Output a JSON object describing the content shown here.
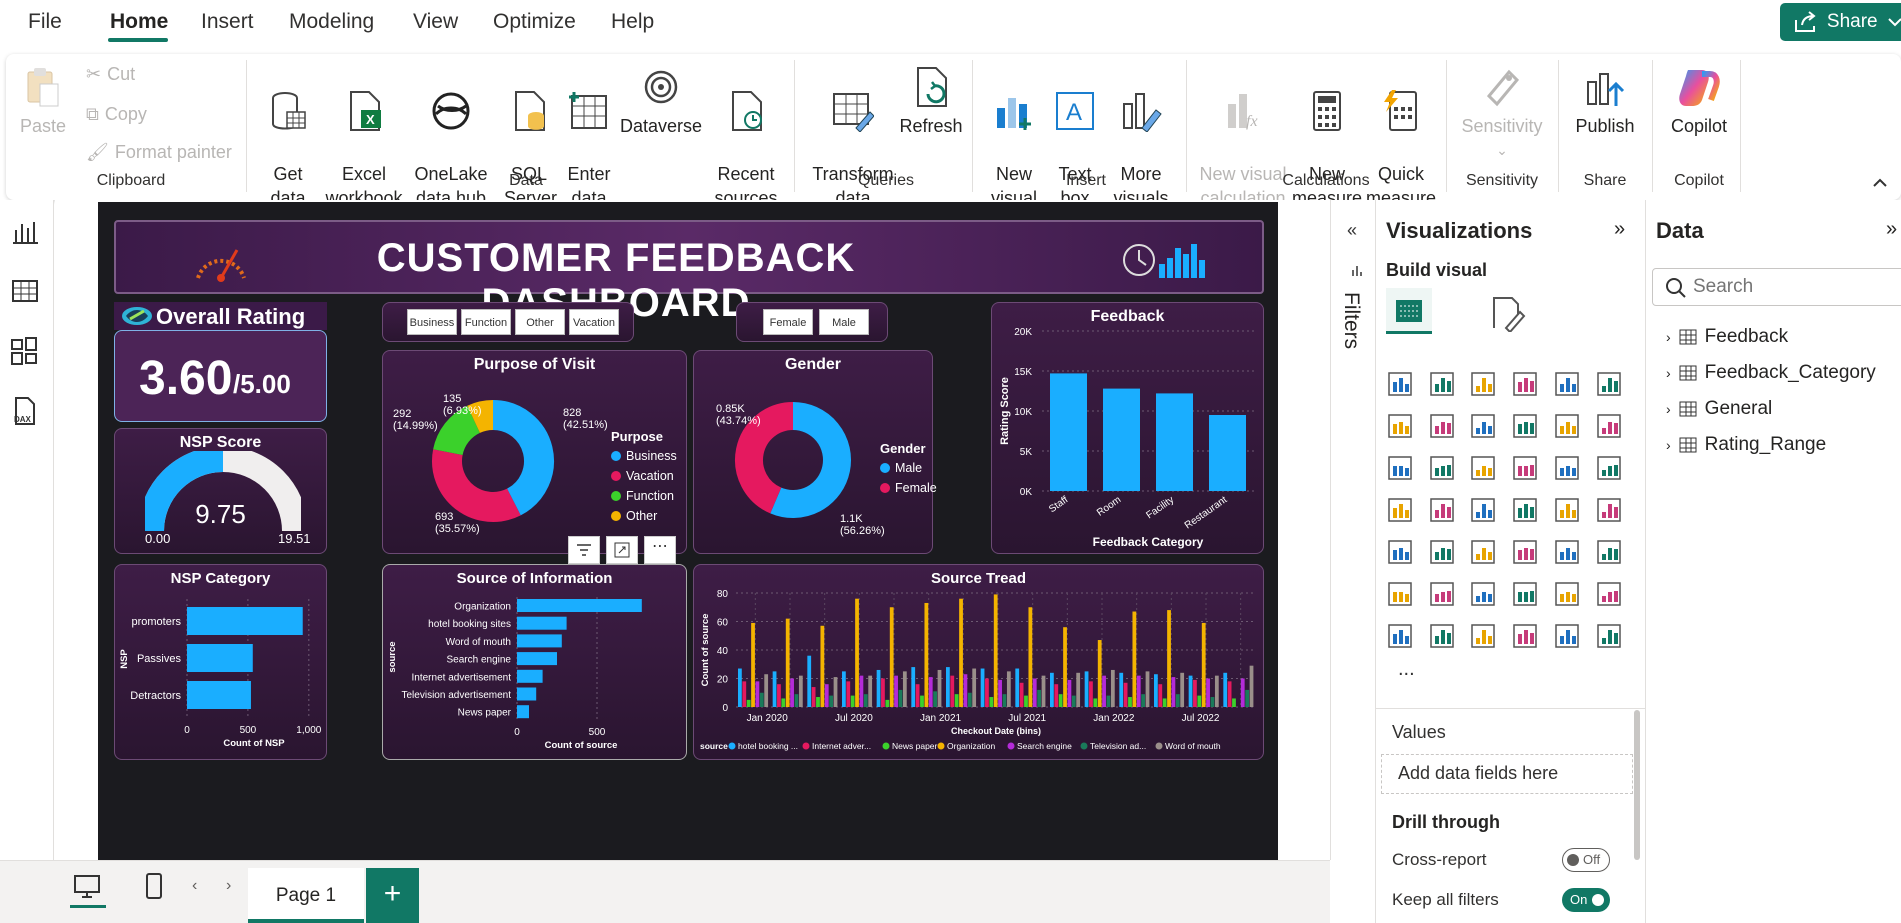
{
  "menu": {
    "items": [
      "File",
      "Home",
      "Insert",
      "Modeling",
      "View",
      "Optimize",
      "Help"
    ],
    "active": "Home",
    "share_label": "Share"
  },
  "ribbon": {
    "clipboard": {
      "paste": "Paste",
      "cut": "Cut",
      "copy": "Copy",
      "format_painter": "Format painter",
      "group": "Clipboard"
    },
    "data": {
      "get_data": "Get\ndata",
      "excel": "Excel\nworkbook",
      "onelake": "OneLake\ndata hub",
      "sql": "SQL\nServer",
      "enter": "Enter\ndata",
      "dataverse": "Dataverse",
      "recent": "Recent\nsources",
      "group": "Data"
    },
    "queries": {
      "transform": "Transform\ndata",
      "refresh": "Refresh",
      "group": "Queries"
    },
    "insert": {
      "new_visual": "New\nvisual",
      "text_box": "Text\nbox",
      "more_visuals": "More\nvisuals",
      "group": "Insert"
    },
    "calculations": {
      "new_visual_calc": "New visual\ncalculation",
      "new_measure": "New\nmeasure",
      "quick_measure": "Quick\nmeasure",
      "group": "Calculations"
    },
    "sensitivity": {
      "label": "Sensitivity",
      "group": "Sensitivity"
    },
    "share": {
      "publish": "Publish",
      "group": "Share"
    },
    "copilot": {
      "label": "Copilot",
      "group": "Copilot"
    }
  },
  "dashboard": {
    "title": "CUSTOMER FEEDBACK DASHBOARD",
    "overall_rating": {
      "label": "Overall Rating",
      "value": "3.60",
      "max": "/5.00"
    },
    "nsp_score": {
      "title": "NSP Score",
      "value": "9.75",
      "min": "0.00",
      "max": "19.51",
      "fraction": 0.5
    },
    "purpose_slicer": [
      "Business",
      "Function",
      "Other",
      "Vacation"
    ],
    "gender_slicer": [
      "Female",
      "Male"
    ],
    "purpose_of_visit": {
      "title": "Purpose of Visit",
      "legend_title": "Purpose",
      "labels": {
        "business": "828\n(42.51%)",
        "vacation": "693\n(35.57%)",
        "function": "292\n(14.99%)",
        "other": "135\n(6.93%)"
      }
    },
    "gender": {
      "title": "Gender",
      "legend_title": "Gender",
      "labels": {
        "female": "0.85K\n(43.74%)",
        "male": "1.1K\n(56.26%)"
      }
    },
    "nsp_category": {
      "title": "NSP Category",
      "ylabel": "NSP",
      "xlabel": "Count of NSP",
      "ticks": [
        "0",
        "500",
        "1,000"
      ]
    },
    "source_info": {
      "title": "Source of Information",
      "ylabel": "source",
      "xlabel": "Count of source",
      "ticks": [
        "0",
        "500"
      ]
    },
    "feedback": {
      "title": "Feedback",
      "ylabel": "Rating Score",
      "xlabel": "Feedback Category",
      "ticks": [
        "0K",
        "5K",
        "10K",
        "15K",
        "20K"
      ]
    },
    "source_trend": {
      "title": "Source Tread",
      "ylabel": "Count of source",
      "xlabel": "Checkout Date (bins)",
      "xticks": [
        "Jan 2020",
        "Jul 2020",
        "Jan 2021",
        "Jul 2021",
        "Jan 2022",
        "Jul 2022"
      ],
      "yticks": [
        "0",
        "20",
        "40",
        "60",
        "80"
      ],
      "legend_title": "source",
      "legend": [
        "hotel booking ...",
        "Internet adver...",
        "News paper",
        "Organization",
        "Search engine",
        "Television ad...",
        "Word of mouth"
      ]
    }
  },
  "chart_data": [
    {
      "type": "pie",
      "title": "Purpose of Visit",
      "categories": [
        "Business",
        "Vacation",
        "Function",
        "Other"
      ],
      "values": [
        828,
        693,
        292,
        135
      ],
      "colors": [
        "#1aaeff",
        "#e5195f",
        "#3bd12b",
        "#f4b400"
      ]
    },
    {
      "type": "pie",
      "title": "Gender",
      "categories": [
        "Male",
        "Female"
      ],
      "values": [
        1100,
        850
      ],
      "colors": [
        "#1aaeff",
        "#e5195f"
      ]
    },
    {
      "type": "bar",
      "title": "NSP Category",
      "categories": [
        "promoters",
        "Passives",
        "Detractors"
      ],
      "values": [
        950,
        540,
        525
      ],
      "xlim": [
        0,
        1100
      ]
    },
    {
      "type": "bar",
      "title": "Source of Information",
      "categories": [
        "Organization",
        "hotel booking sites",
        "Word of mouth",
        "Search engine",
        "Internet advertisement",
        "Television advertisement",
        "News paper"
      ],
      "values": [
        780,
        310,
        280,
        250,
        160,
        120,
        75
      ],
      "xlim": [
        0,
        800
      ]
    },
    {
      "type": "bar",
      "title": "Feedback",
      "categories": [
        "Staff",
        "Room",
        "Facility",
        "Restaurant"
      ],
      "values": [
        14700,
        12800,
        12200,
        9500
      ],
      "ylim": [
        0,
        20000
      ]
    },
    {
      "type": "bar",
      "title": "Source Tread",
      "series": [
        {
          "name": "hotel booking ...",
          "color": "#1aaeff",
          "values": [
            27,
            25,
            36,
            25,
            26,
            28,
            28,
            27,
            27,
            24,
            25,
            24,
            23,
            22,
            24
          ]
        },
        {
          "name": "Internet adver...",
          "color": "#e5195f",
          "values": [
            18,
            16,
            14,
            18,
            20,
            16,
            22,
            20,
            17,
            16,
            18,
            17,
            16,
            19,
            18
          ]
        },
        {
          "name": "News paper",
          "color": "#3bd12b",
          "values": [
            5,
            6,
            7,
            8,
            5,
            8,
            9,
            7,
            8,
            9,
            6,
            7,
            6,
            8,
            6
          ]
        },
        {
          "name": "Organization",
          "color": "#f4b400",
          "values": [
            59,
            62,
            57,
            76,
            70,
            73,
            76,
            79,
            70,
            56,
            47,
            67,
            68,
            59,
            0
          ]
        },
        {
          "name": "Search engine",
          "color": "#b42bd8",
          "values": [
            18,
            20,
            16,
            22,
            22,
            21,
            23,
            19,
            20,
            19,
            22,
            22,
            21,
            20,
            20
          ]
        },
        {
          "name": "Television ad...",
          "color": "#1a7a5a",
          "values": [
            10,
            9,
            8,
            9,
            12,
            11,
            10,
            9,
            12,
            8,
            8,
            9,
            9,
            7,
            12
          ]
        },
        {
          "name": "Word of mouth",
          "color": "#9a8f8a",
          "values": [
            23,
            22,
            21,
            22,
            25,
            26,
            27,
            25,
            22,
            24,
            26,
            25,
            24,
            22,
            29
          ]
        }
      ],
      "ylim": [
        0,
        80
      ]
    }
  ],
  "viz_pane": {
    "title": "Visualizations",
    "build_visual": "Build visual",
    "values_label": "Values",
    "add_fields": "Add data fields here",
    "drill_through": "Drill through",
    "cross_report": "Cross-report",
    "cross_report_state": "Off",
    "keep_filters": "Keep all filters",
    "keep_filters_state": "On",
    "filters_label": "Filters",
    "more": "..."
  },
  "data_pane": {
    "title": "Data",
    "search_placeholder": "Search",
    "tables": [
      "Feedback",
      "Feedback_Category",
      "General",
      "Rating_Range"
    ]
  },
  "pages": {
    "current": "Page 1",
    "add": "+"
  }
}
